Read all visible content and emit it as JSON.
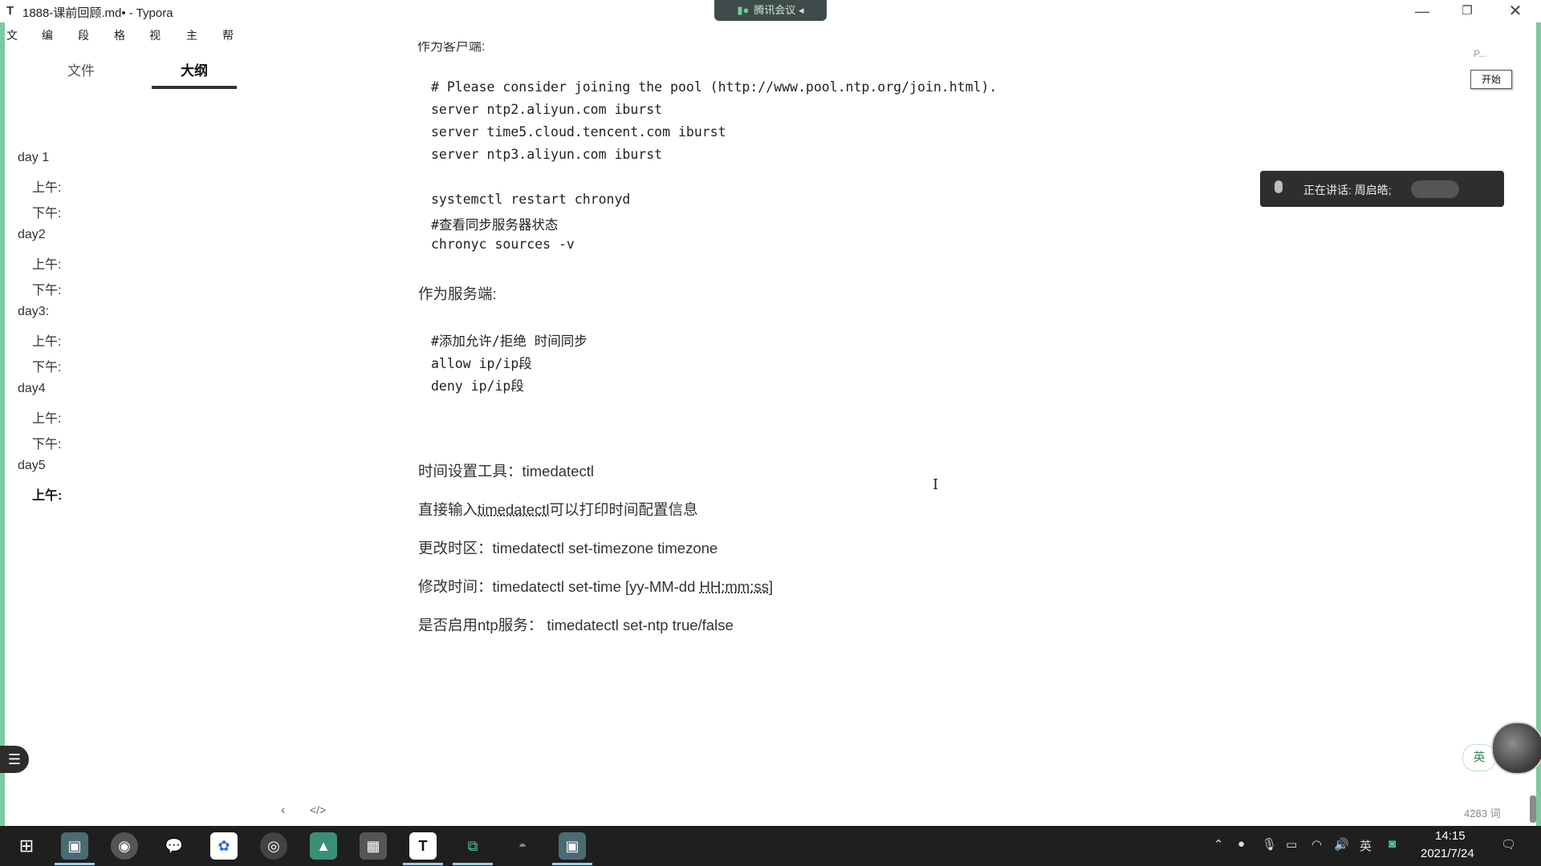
{
  "window": {
    "app_icon": "T",
    "title": "1888-课前回顾.md• - Typora",
    "minimize": "—",
    "maximize": "❐",
    "close": "✕"
  },
  "meeting": {
    "label": "腾讯会议"
  },
  "menu": [
    "文件",
    "编辑",
    "段落",
    "格式",
    "视图",
    "主题",
    "帮助"
  ],
  "sidebar": {
    "tab_files": "文件",
    "tab_outline": "大纲",
    "outline": [
      {
        "label": "day 1",
        "level": 1
      },
      {
        "label": "上午:",
        "level": 2
      },
      {
        "label": "下午:",
        "level": 2
      },
      {
        "label": "day2",
        "level": 1
      },
      {
        "label": "上午:",
        "level": 2
      },
      {
        "label": "下午:",
        "level": 2
      },
      {
        "label": "day3:",
        "level": 1
      },
      {
        "label": "上午:",
        "level": 2
      },
      {
        "label": "下午:",
        "level": 2
      },
      {
        "label": "day4",
        "level": 1
      },
      {
        "label": "上午:",
        "level": 2
      },
      {
        "label": "下午:",
        "level": 2
      },
      {
        "label": "day5",
        "level": 1
      },
      {
        "label": "上午:",
        "level": 2,
        "active": true
      }
    ]
  },
  "editor": {
    "partial_heading": "作为客户端:",
    "code1": [
      "# Please consider joining the pool (http://www.pool.ntp.org/join.html).",
      "server ntp2.aliyun.com iburst",
      "server time5.cloud.tencent.com iburst",
      "server ntp3.aliyun.com iburst",
      "",
      "systemctl restart chronyd",
      "#查看同步服务器状态",
      "chronyc sources -v"
    ],
    "server_heading": "作为服务端:",
    "code2": [
      "#添加允许/拒绝 时间同步",
      "allow ip/ip段",
      "deny ip/ip段"
    ],
    "p1": "时间设置工具：timedatectl",
    "p2_a": "直接输入",
    "p2_b": "timedatectl",
    "p2_c": "可以打印时间配置信息",
    "p3": "更改时区：timedatectl set-timezone timezone",
    "p4_a": "修改时间：timedatectl set-time [yy-MM-dd ",
    "p4_b": "HH:mm:ss",
    "p4_c": "]",
    "p5": "是否启用ntp服务： timedatectl set-ntp true/false"
  },
  "overlay": {
    "ppt_label": "P...",
    "start_button": "开始",
    "speaking": "正在讲话: 周启皓;",
    "ime": "英"
  },
  "footer": {
    "back": "‹",
    "source": "</>",
    "wordcount": "4283 词"
  },
  "taskbar": {
    "tray_ime": "英",
    "time": "14:15",
    "date": "2021/7/24"
  }
}
